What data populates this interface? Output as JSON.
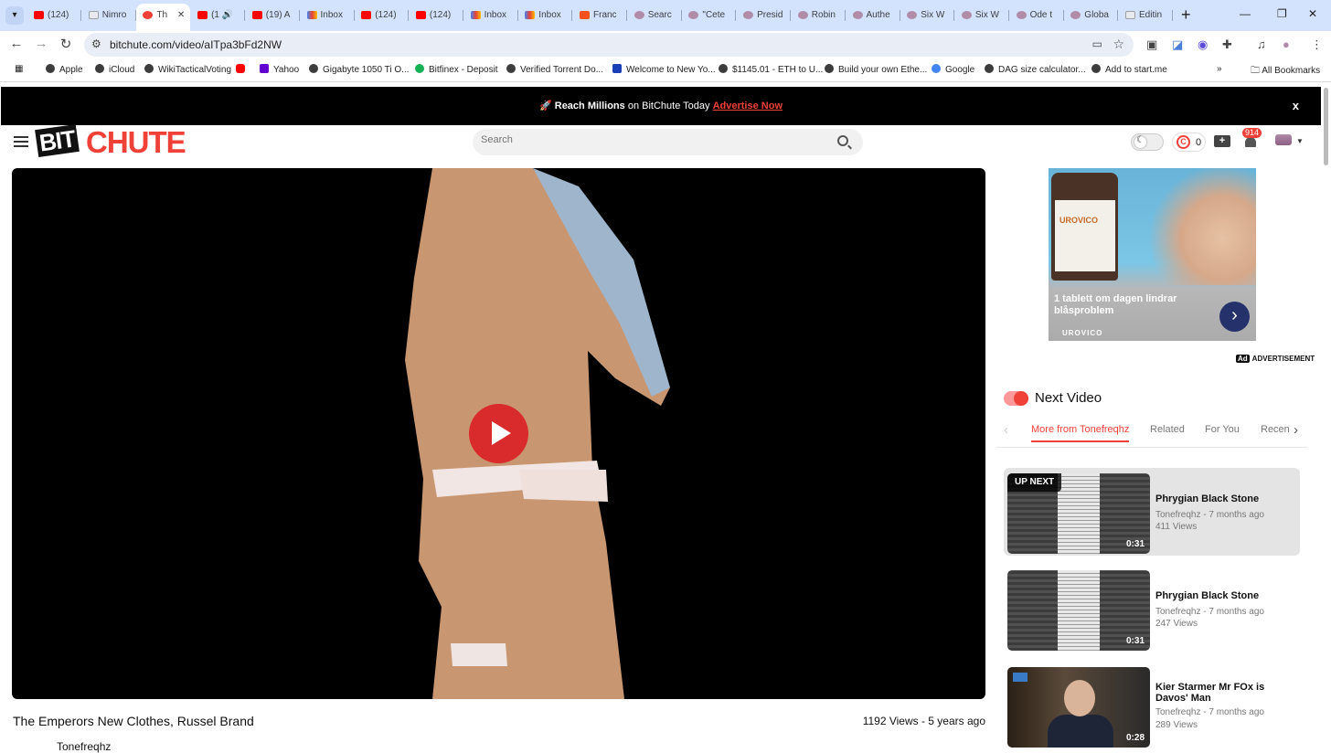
{
  "browser": {
    "tabs": [
      {
        "label": "(124)",
        "fav": "yt"
      },
      {
        "label": "Nimro",
        "fav": "doc"
      },
      {
        "label": "Th",
        "fav": "bc",
        "active": true
      },
      {
        "label": "(1",
        "fav": "yt",
        "audio": true
      },
      {
        "label": "(19) A",
        "fav": "yt"
      },
      {
        "label": "Inbox",
        "fav": "gm"
      },
      {
        "label": "(124)",
        "fav": "yt"
      },
      {
        "label": "(124)",
        "fav": "yt"
      },
      {
        "label": "Inbox",
        "fav": "gm"
      },
      {
        "label": "Inbox",
        "fav": "gm"
      },
      {
        "label": "Franc",
        "fav": "or"
      },
      {
        "label": "Searc",
        "fav": "av"
      },
      {
        "label": "\"Cete",
        "fav": "av"
      },
      {
        "label": "Presid",
        "fav": "av"
      },
      {
        "label": "Robin",
        "fav": "av"
      },
      {
        "label": "Authe",
        "fav": "av"
      },
      {
        "label": "Six W",
        "fav": "av"
      },
      {
        "label": "Six W",
        "fav": "av"
      },
      {
        "label": "Ode t",
        "fav": "av"
      },
      {
        "label": "Globa",
        "fav": "av"
      },
      {
        "label": "Editin",
        "fav": "doc"
      }
    ],
    "new_tab_label": "+",
    "url": "bitchute.com/video/aITpa3bFd2NW",
    "bookmarks": [
      "Apple",
      "iCloud",
      "WikiTacticalVoting",
      "",
      "Yahoo",
      "Gigabyte 1050 Ti O...",
      "Bitfinex - Deposit",
      "Verified Torrent Do...",
      "Welcome to New Yo...",
      "$1145.01 - ETH to U...",
      "Build your own Ethe...",
      "Google",
      "DAG size calculator...",
      "Add to start.me"
    ],
    "more_bookmarks": "»",
    "all_bookmarks": "All Bookmarks"
  },
  "promo": {
    "prefix": "Reach Millions",
    "middle": " on BitChute Today ",
    "link": "Advertise Now",
    "close": "x"
  },
  "header": {
    "logo_left": "BIT",
    "logo_right": "CHUTE",
    "search_placeholder": "Search",
    "coins": "0",
    "notifications": "914"
  },
  "video": {
    "title": "The Emperors New Clothes, Russel Brand",
    "meta": "1192 Views - 5 years ago",
    "channel": "Tonefreqhz"
  },
  "ad": {
    "bottle_brand": "UROVICO",
    "text": "1 tablett om dagen lindrar blåsproblem",
    "brand": "UROVICO",
    "tag": "ADVERTISEMENT"
  },
  "sidebar": {
    "next_title": "Next Video",
    "tabs": [
      "More from Tonefreqhz",
      "Related",
      "For You",
      "Recen"
    ],
    "up_next": "UP NEXT",
    "items": [
      {
        "title": "Phrygian Black Stone",
        "channel": "Tonefreqhz - 7 months ago",
        "views": "411 Views",
        "duration": "0:31"
      },
      {
        "title": "Phrygian Black Stone",
        "channel": "Tonefreqhz - 7 months ago",
        "views": "247 Views",
        "duration": "0:31"
      },
      {
        "title": "Kier Starmer Mr FOx is Davos' Man",
        "channel": "Tonefreqhz - 7 months ago",
        "views": "289 Views",
        "duration": "0:28"
      }
    ]
  }
}
